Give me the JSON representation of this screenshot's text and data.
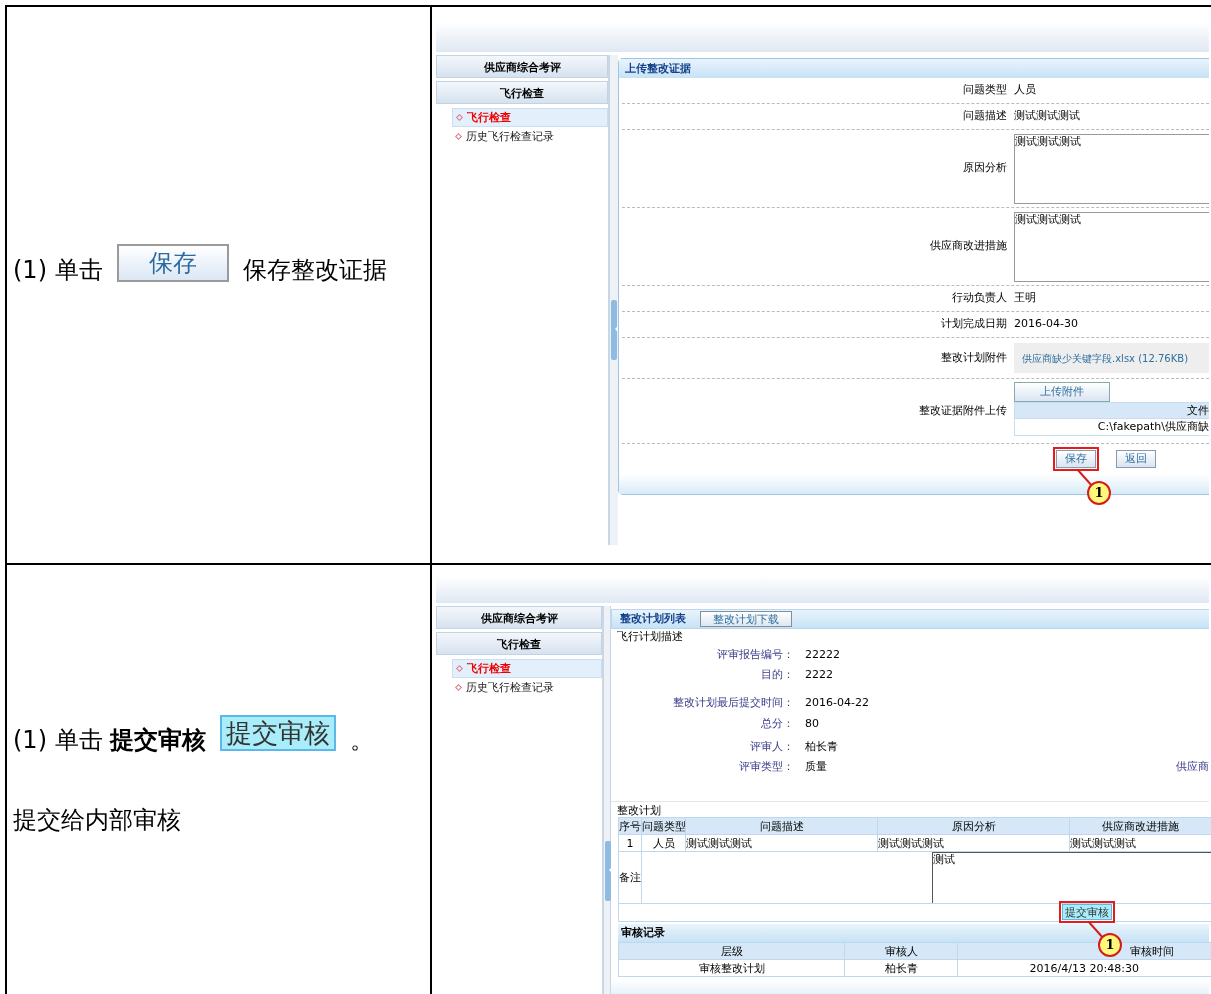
{
  "step_1": {
    "instruction": {
      "lead": "(1) 单击",
      "button": "保存",
      "tail": "保存整改证据"
    },
    "screen": {
      "sidebar": {
        "headers": [
          "供应商综合考评",
          "飞行检查"
        ],
        "items": [
          {
            "label": "飞行检查",
            "selected": true
          },
          {
            "label": "历史飞行检查记录",
            "selected": false
          }
        ]
      },
      "panel_title": "上传整改证据",
      "rows": [
        {
          "kind": "text",
          "label": "问题类型",
          "value": "人员"
        },
        {
          "kind": "text",
          "label": "问题描述",
          "value": "测试测试测试"
        },
        {
          "kind": "textarea",
          "label": "原因分析",
          "value": "测试测试测试"
        },
        {
          "kind": "textarea",
          "label": "供应商改进措施",
          "value": "测试测试测试"
        },
        {
          "kind": "text",
          "label": "行动负责人",
          "value": "王明"
        },
        {
          "kind": "text",
          "label": "计划完成日期",
          "value": "2016-04-30"
        },
        {
          "kind": "attachment",
          "label": "整改计划附件",
          "value": "供应商缺少关键字段.xlsx (12.76KB)"
        },
        {
          "kind": "upload",
          "label": "整改证据附件上传",
          "button": "上传附件",
          "column": "文件",
          "file": "C:\\fakepath\\供应商缺"
        }
      ],
      "buttons": [
        {
          "label": "保存",
          "highlighted": true
        },
        {
          "label": "返回",
          "highlighted": false
        }
      ],
      "callout": "1"
    }
  },
  "step_2": {
    "instruction": {
      "lead": "(1) 单击 **提交审核**",
      "button": "提交审核",
      "tail": "。",
      "note": "提交给内部审核"
    },
    "screen": {
      "sidebar": {
        "headers": [
          "供应商综合考评",
          "飞行检查"
        ],
        "items": [
          {
            "label": "飞行检查",
            "selected": true
          },
          {
            "label": "历史飞行检查记录",
            "selected": false
          }
        ]
      },
      "title": "整改计划列表",
      "download_button": "整改计划下载",
      "legend": "飞行计划描述",
      "fields": [
        {
          "label": "评审报告编号：",
          "value": "22222"
        },
        {
          "label": "目的：",
          "value": "2222"
        },
        {
          "label": "整改计划最后提交时间：",
          "value": "2016-04-22"
        },
        {
          "label": "总分：",
          "value": "80"
        },
        {
          "label": "评审人：",
          "value": "柏长青"
        },
        {
          "label": "评审类型：",
          "value": "质量",
          "extra": "供应商"
        }
      ],
      "plan_label": "整改计划",
      "plan_columns": [
        "序号",
        "问题类型",
        "问题描述",
        "原因分析",
        "供应商改进措施"
      ],
      "plan_rows": [
        [
          "1",
          "人员",
          "测试测试测试",
          "测试测试测试",
          "测试测试测试"
        ]
      ],
      "remark_label": "备注",
      "remark": "测试",
      "submit": {
        "label": "提交审核",
        "highlighted": true
      },
      "callout": "1",
      "record_title": "审核记录",
      "record_columns": [
        "层级",
        "审核人",
        "审核时间"
      ],
      "record_rows": [
        [
          "审核整改计划",
          "柏长青",
          "2016/4/13 20:48:30"
        ]
      ]
    }
  }
}
